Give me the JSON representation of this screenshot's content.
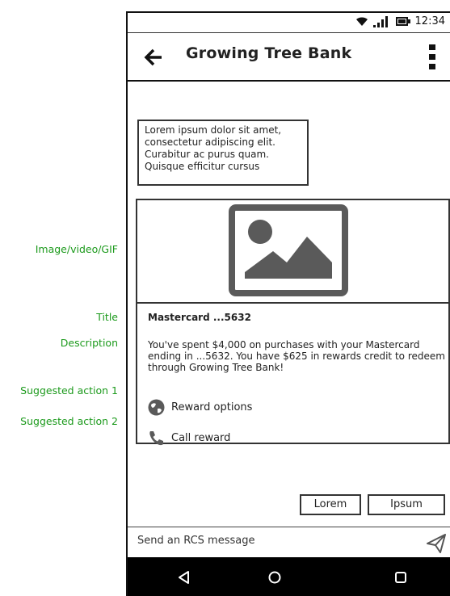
{
  "annotations": {
    "media": "Image/video/GIF",
    "title": "Title",
    "description": "Description",
    "action1": "Suggested action 1",
    "action2": "Suggested action 2"
  },
  "status_bar": {
    "time": "12:34",
    "icons": [
      "wifi-icon",
      "signal-icon",
      "battery-icon"
    ]
  },
  "app_bar": {
    "title": "Growing Tree Bank",
    "back_icon": "arrow-left-icon",
    "menu_icon": "more-vert-icon"
  },
  "message": {
    "text": "Lorem ipsum dolor sit amet, consectetur adipiscing elit. Curabitur ac purus quam. Quisque efficitur cursus"
  },
  "rich_card": {
    "media_icon": "image-placeholder-icon",
    "title": "Mastercard ...5632",
    "description": "You've spent $4,000 on purchases with your Mastercard ending in ...5632. You have $625 in rewards credit to redeem through Growing Tree Bank!",
    "actions": [
      {
        "label": "Reward options",
        "icon": "globe-icon"
      },
      {
        "label": "Call reward",
        "icon": "phone-icon"
      }
    ]
  },
  "suggested_replies": [
    "Lorem",
    "Ipsum"
  ],
  "composer": {
    "placeholder": "Send an RCS message",
    "send_icon": "send-icon"
  },
  "nav_bar": {
    "icons": [
      "back-triangle-icon",
      "home-circle-icon",
      "recents-square-icon"
    ]
  },
  "colors": {
    "annotation": "#1c9a1c",
    "ink": "#222222",
    "media_fill": "#5a5a5a",
    "nav_bg": "#000000"
  }
}
